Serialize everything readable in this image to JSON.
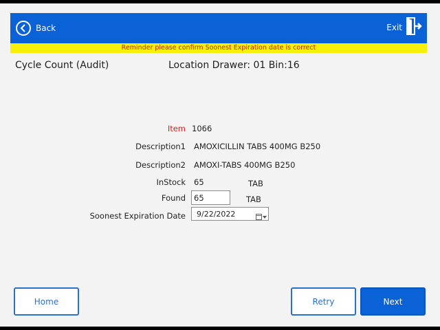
{
  "header": {
    "back_label": "Back",
    "exit_label": "Exit"
  },
  "reminder": "Reminder please confirm Soonest Expiration date is correct",
  "title": "Cycle Count (Audit)",
  "location": "Location Drawer: 01 Bin:16",
  "form": {
    "item_label": "Item",
    "item_value": "1066",
    "desc1_label": "Description1",
    "desc1_value": "AMOXICILLIN TABS 400MG B250",
    "desc2_label": "Description2",
    "desc2_value": "AMOXI-TABS 400MG B250",
    "instock_label": "InStock",
    "instock_value": "65",
    "instock_unit": "TAB",
    "found_label": "Found",
    "found_value": "65",
    "found_unit": "TAB",
    "expiration_label": "Soonest Expiration Date",
    "expiration_value": "9/22/2022"
  },
  "buttons": {
    "home": "Home",
    "retry": "Retry",
    "next": "Next"
  },
  "colors": {
    "primary": "#0b61d6",
    "reminder_bg": "#f6ef08",
    "reminder_text": "#c8201e",
    "item_label": "#d21f1f"
  }
}
